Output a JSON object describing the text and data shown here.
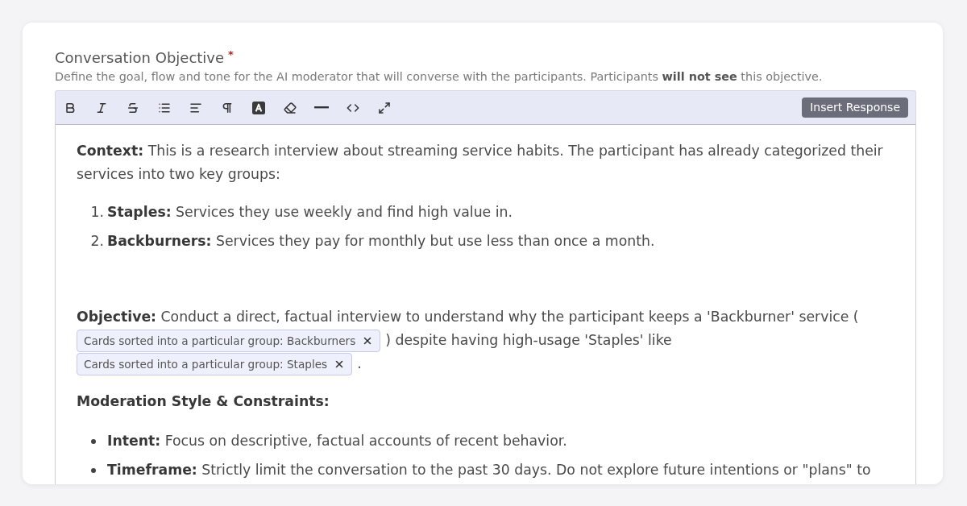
{
  "field": {
    "label": "Conversation Objective",
    "required_mark": "*",
    "description": "Define the goal, flow and tone for the AI moderator that will converse with the participants. Participants **will not see** this objective."
  },
  "toolbar": {
    "tools": [
      {
        "kind": "bold"
      },
      {
        "kind": "italic"
      },
      {
        "kind": "strikethrough"
      },
      {
        "kind": "bulleted_list"
      },
      {
        "kind": "align"
      },
      {
        "kind": "paragraph"
      },
      {
        "kind": "text_color"
      },
      {
        "kind": "eraser"
      },
      {
        "kind": "horizontal_rule"
      },
      {
        "kind": "code"
      },
      {
        "kind": "fullscreen"
      }
    ],
    "insert_button": "Insert Response"
  },
  "editor": {
    "blocks": [
      {
        "kind": "paragraph",
        "text": "**Context:** This is a research interview about streaming service habits. The participant has already categorized their services into two key groups:"
      },
      {
        "kind": "ordered_list",
        "items": [
          {
            "marker": "1.",
            "text": "**Staples:** Services they use weekly and find high value in."
          },
          {
            "marker": "2.",
            "text": "**Backburners:** Services they pay for monthly but use less than once a month."
          }
        ]
      },
      {
        "kind": "mixed_paragraph",
        "parts": [
          {
            "kind": "text",
            "text": "**Objective:** Conduct a direct, factual interview to understand why the participant keeps a 'Backburner' service ("
          },
          {
            "kind": "chip",
            "text": "Cards sorted into a particular group: Backburners"
          },
          {
            "kind": "text",
            "text": ") despite having high-usage 'Staples' like"
          },
          {
            "kind": "chip",
            "text": "Cards sorted into a particular group: Staples"
          },
          {
            "kind": "text",
            "text": "."
          }
        ]
      },
      {
        "kind": "bold_paragraph",
        "text": "Moderation Style & Constraints:"
      },
      {
        "kind": "bulleted_list",
        "items": [
          {
            "text": "**Intent:** Focus on descriptive, factual accounts of recent behavior."
          },
          {
            "text": "**Timeframe:** Strictly limit the conversation to the past 30 days. Do not explore future intentions or \"plans\" to"
          }
        ]
      }
    ]
  }
}
